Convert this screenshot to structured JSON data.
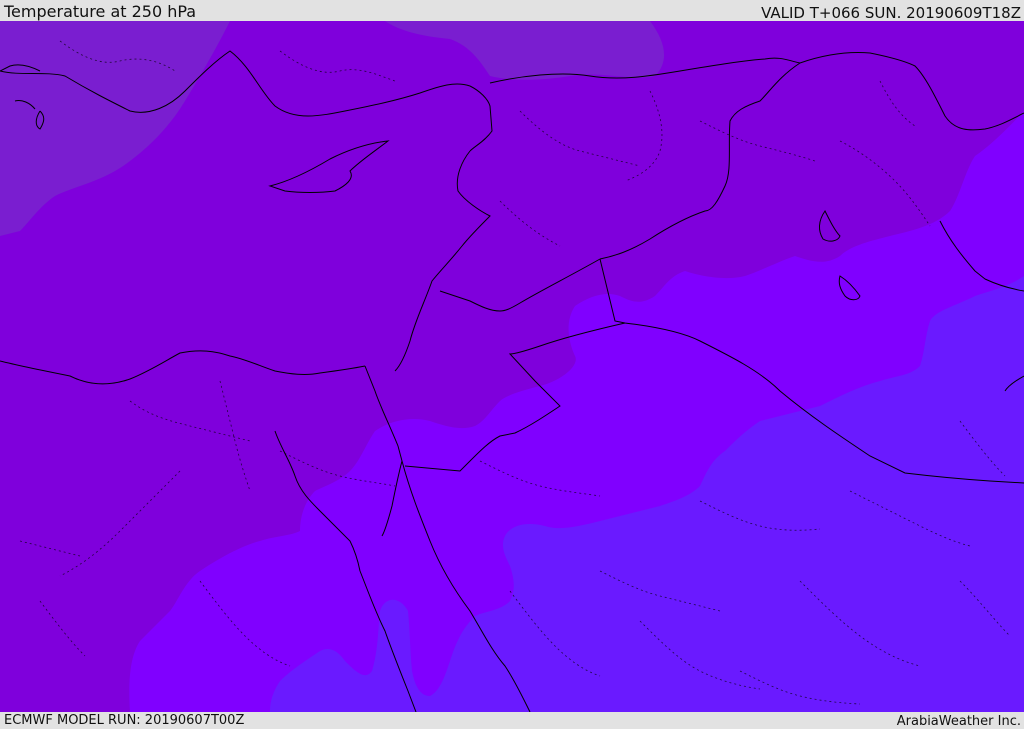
{
  "header": {
    "title": "Temperature at 250 hPa",
    "valid": "VALID T+066 SUN. 20190609T18Z"
  },
  "footer": {
    "model_run": "ECMWF MODEL RUN: 20190607T00Z",
    "brand": "ArabiaWeather Inc."
  },
  "map": {
    "field": "temperature",
    "level": "250 hPa",
    "colors": {
      "coldest_band": "#7a1ed0",
      "cold_band": "#7f00dc",
      "mid_band": "#8000ff",
      "warm_band": "#6a1aff",
      "border_line": "#000000"
    }
  }
}
